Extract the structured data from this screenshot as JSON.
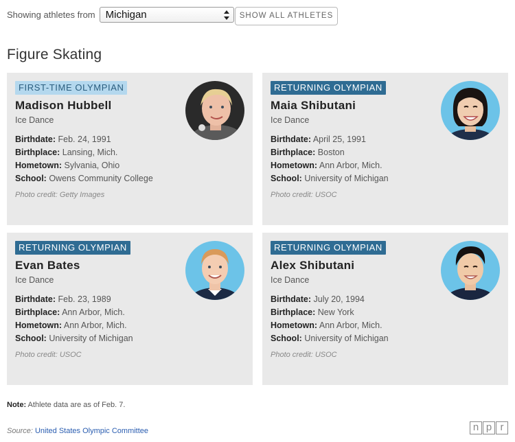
{
  "filter": {
    "label": "Showing athletes from",
    "selected": "Michigan",
    "show_all_label": "SHOW ALL ATHLETES"
  },
  "section": {
    "title": "Figure Skating"
  },
  "field_labels": {
    "birthdate": "Birthdate:",
    "birthplace": "Birthplace:",
    "hometown": "Hometown:",
    "school": "School:"
  },
  "athletes": [
    {
      "badge": "FIRST-TIME OLYMPIAN",
      "name": "Madison Hubbell",
      "sport": "Ice Dance",
      "birthdate": "Feb. 24, 1991",
      "birthplace": "Lansing, Mich.",
      "hometown": "Sylvania, Ohio",
      "school": "Owens Community College",
      "credit": "Photo credit: Getty Images"
    },
    {
      "badge": "RETURNING OLYMPIAN",
      "name": "Maia Shibutani",
      "sport": "Ice Dance",
      "birthdate": "April 25, 1991",
      "birthplace": "Boston",
      "hometown": "Ann Arbor, Mich.",
      "school": "University of Michigan",
      "credit": "Photo credit: USOC"
    },
    {
      "badge": "RETURNING OLYMPIAN",
      "name": "Evan Bates",
      "sport": "Ice Dance",
      "birthdate": "Feb. 23, 1989",
      "birthplace": "Ann Arbor, Mich.",
      "hometown": "Ann Arbor, Mich.",
      "school": "University of Michigan",
      "credit": "Photo credit: USOC"
    },
    {
      "badge": "RETURNING OLYMPIAN",
      "name": "Alex Shibutani",
      "sport": "Ice Dance",
      "birthdate": "July 20, 1994",
      "birthplace": "New York",
      "hometown": "Ann Arbor, Mich.",
      "school": "University of Michigan",
      "credit": "Photo credit: USOC"
    }
  ],
  "footer": {
    "note_label": "Note:",
    "note_text": " Athlete data are as of Feb. 7.",
    "source_label": "Source: ",
    "source_link": "United States Olympic Committee",
    "logo_letters": [
      "n",
      "p",
      "r"
    ]
  },
  "colors": {
    "first_time_badge": "#b4d8ee",
    "returning_badge": "#2f6c93",
    "card_bg": "#e9e9e9",
    "photo_bg": "#6cc3e8",
    "link": "#2a5db0"
  },
  "icons": [
    "select-arrows-icon",
    "athlete-photo",
    "npr-logo"
  ]
}
